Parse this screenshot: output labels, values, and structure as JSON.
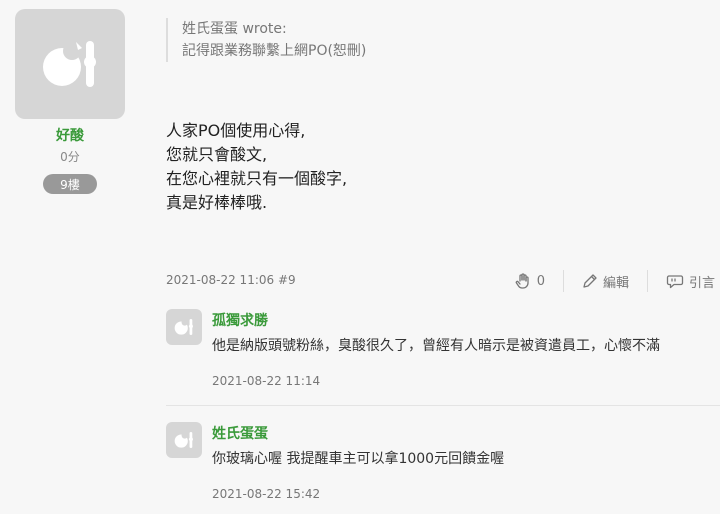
{
  "post": {
    "author": {
      "name": "好酸",
      "score": "0分",
      "floor": "9樓"
    },
    "quote": {
      "author_line": "姓氏蛋蛋 wrote:",
      "text": "記得跟業務聯繫上網PO(恕刪)"
    },
    "body_lines": [
      "人家PO個使用心得,",
      "您就只會酸文,",
      "在您心裡就只有一個酸字,",
      "真是好棒棒哦."
    ],
    "meta": "2021-08-22 11:06 #9",
    "actions": {
      "like_count": "0",
      "edit_label": "編輯",
      "quote_label": "引言"
    }
  },
  "comments": [
    {
      "name": "孤獨求勝",
      "text": "他是納版頭號粉絲，臭酸很久了，曾經有人暗示是被資遣員工，心懷不滿",
      "time": "2021-08-22 11:14"
    },
    {
      "name": "姓氏蛋蛋",
      "text": "你玻璃心喔 我提醒車主可以拿1000元回饋金喔",
      "time": "2021-08-22 15:42"
    }
  ],
  "colors": {
    "accent_green": "#3a9a3a",
    "avatar_bg": "#d6d6d6",
    "badge_bg": "#999999"
  },
  "icons": {
    "avatar": "default-avatar-icon",
    "like": "clap-hand-icon",
    "edit": "pencil-icon",
    "quote": "quote-bubble-icon"
  }
}
